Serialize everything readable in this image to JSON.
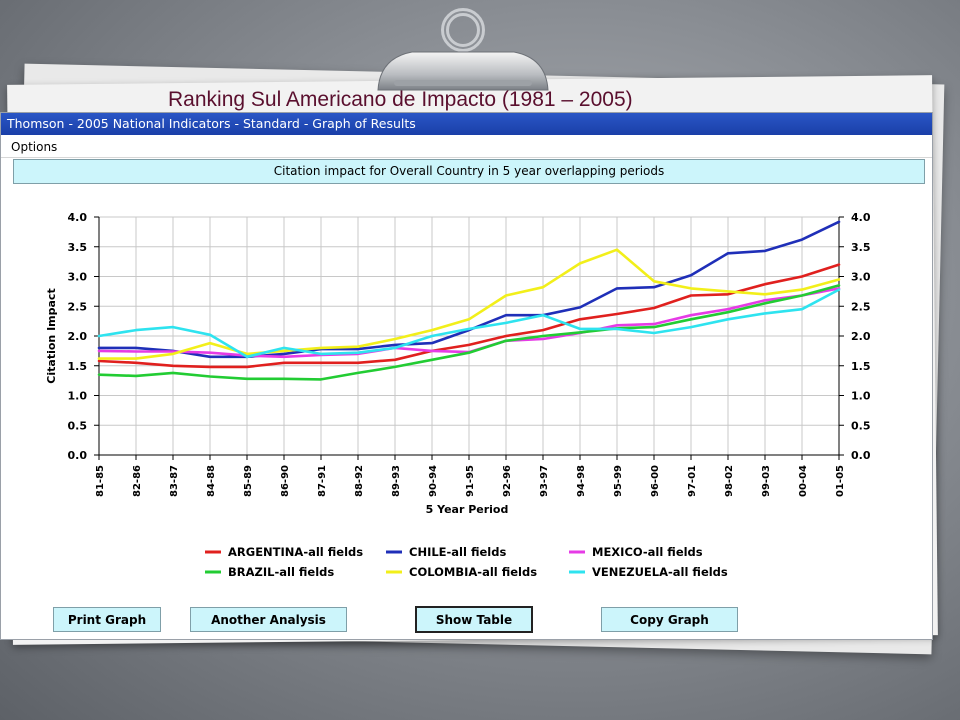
{
  "slide": {
    "title": "Ranking Sul Americano de Impacto (1981 – 2005)"
  },
  "window": {
    "title": "Thomson - 2005 National Indicators - Standard - Graph of Results",
    "menu": [
      "Options"
    ],
    "banner": "Citation impact for Overall Country in 5 year overlapping periods"
  },
  "buttons": {
    "print": "Print Graph",
    "another": "Another Analysis",
    "show_table": "Show Table",
    "copy": "Copy Graph"
  },
  "colors": {
    "ARGENTINA": "#e0201e",
    "CHILE": "#1f2fb8",
    "MEXICO": "#e63be6",
    "BRAZIL": "#22cc33",
    "COLOMBIA": "#f2ef1a",
    "VENEZUELA": "#2ee3ef"
  },
  "chart_data": {
    "type": "line",
    "xlabel": "5 Year Period",
    "ylabel": "Citation Impact",
    "ylim": [
      0.0,
      4.0
    ],
    "yticks": [
      "0.0",
      "0.5",
      "1.0",
      "1.5",
      "2.0",
      "2.5",
      "3.0",
      "3.5",
      "4.0"
    ],
    "categories": [
      "81-85",
      "82-86",
      "83-87",
      "84-88",
      "85-89",
      "86-90",
      "87-91",
      "88-92",
      "89-93",
      "90-94",
      "91-95",
      "92-96",
      "93-97",
      "94-98",
      "95-99",
      "96-00",
      "97-01",
      "98-02",
      "99-03",
      "00-04",
      "01-05"
    ],
    "grid": true,
    "legend_position": "bottom",
    "series": [
      {
        "name": "ARGENTINA-all fields",
        "key": "ARGENTINA",
        "values": [
          1.58,
          1.55,
          1.5,
          1.48,
          1.48,
          1.55,
          1.55,
          1.55,
          1.6,
          1.75,
          1.85,
          2.0,
          2.1,
          2.28,
          2.37,
          2.47,
          2.68,
          2.7,
          2.87,
          3.0,
          3.2
        ]
      },
      {
        "name": "CHILE-all fields",
        "key": "CHILE",
        "values": [
          1.8,
          1.8,
          1.75,
          1.65,
          1.65,
          1.7,
          1.78,
          1.78,
          1.85,
          1.88,
          2.1,
          2.35,
          2.35,
          2.48,
          2.8,
          2.82,
          3.02,
          3.39,
          3.43,
          3.62,
          3.92
        ]
      },
      {
        "name": "MEXICO-all fields",
        "key": "MEXICO",
        "values": [
          1.75,
          1.74,
          1.74,
          1.72,
          1.67,
          1.65,
          1.68,
          1.7,
          1.8,
          1.75,
          1.73,
          1.92,
          1.95,
          2.05,
          2.18,
          2.2,
          2.35,
          2.45,
          2.6,
          2.68,
          2.8
        ]
      },
      {
        "name": "BRAZIL-all fields",
        "key": "BRAZIL",
        "values": [
          1.35,
          1.33,
          1.38,
          1.32,
          1.28,
          1.28,
          1.27,
          1.38,
          1.48,
          1.6,
          1.72,
          1.92,
          2.0,
          2.06,
          2.13,
          2.15,
          2.28,
          2.4,
          2.55,
          2.68,
          2.85
        ]
      },
      {
        "name": "COLOMBIA-all fields",
        "key": "COLOMBIA",
        "values": [
          1.62,
          1.62,
          1.7,
          1.88,
          1.7,
          1.75,
          1.8,
          1.82,
          1.95,
          2.1,
          2.28,
          2.68,
          2.82,
          3.22,
          3.45,
          2.92,
          2.8,
          2.75,
          2.7,
          2.78,
          2.95
        ]
      },
      {
        "name": "VENEZUELA-all fields",
        "key": "VENEZUELA",
        "values": [
          2.0,
          2.1,
          2.15,
          2.02,
          1.65,
          1.8,
          1.7,
          1.72,
          1.8,
          2.0,
          2.12,
          2.22,
          2.35,
          2.12,
          2.12,
          2.05,
          2.15,
          2.28,
          2.38,
          2.45,
          2.78
        ]
      }
    ]
  }
}
